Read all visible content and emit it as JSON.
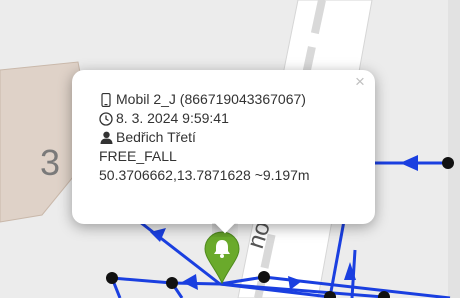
{
  "popup": {
    "device": "Mobil 2_J (866719043367067)",
    "datetime": "8. 3. 2024 9:59:41",
    "person": "Bedřich Třetí",
    "event": "FREE_FALL",
    "coords": "50.3706662,13.7871628 ~9.197m",
    "close_label": "×",
    "icons": {
      "device": "mobile-phone-icon",
      "datetime": "clock-icon",
      "person": "user-icon"
    }
  },
  "map": {
    "label_building": "3",
    "label_street": "no",
    "track_color": "#1a3fe0",
    "marker_color": "#6aaa2b",
    "marker_icon": "bell-icon"
  }
}
